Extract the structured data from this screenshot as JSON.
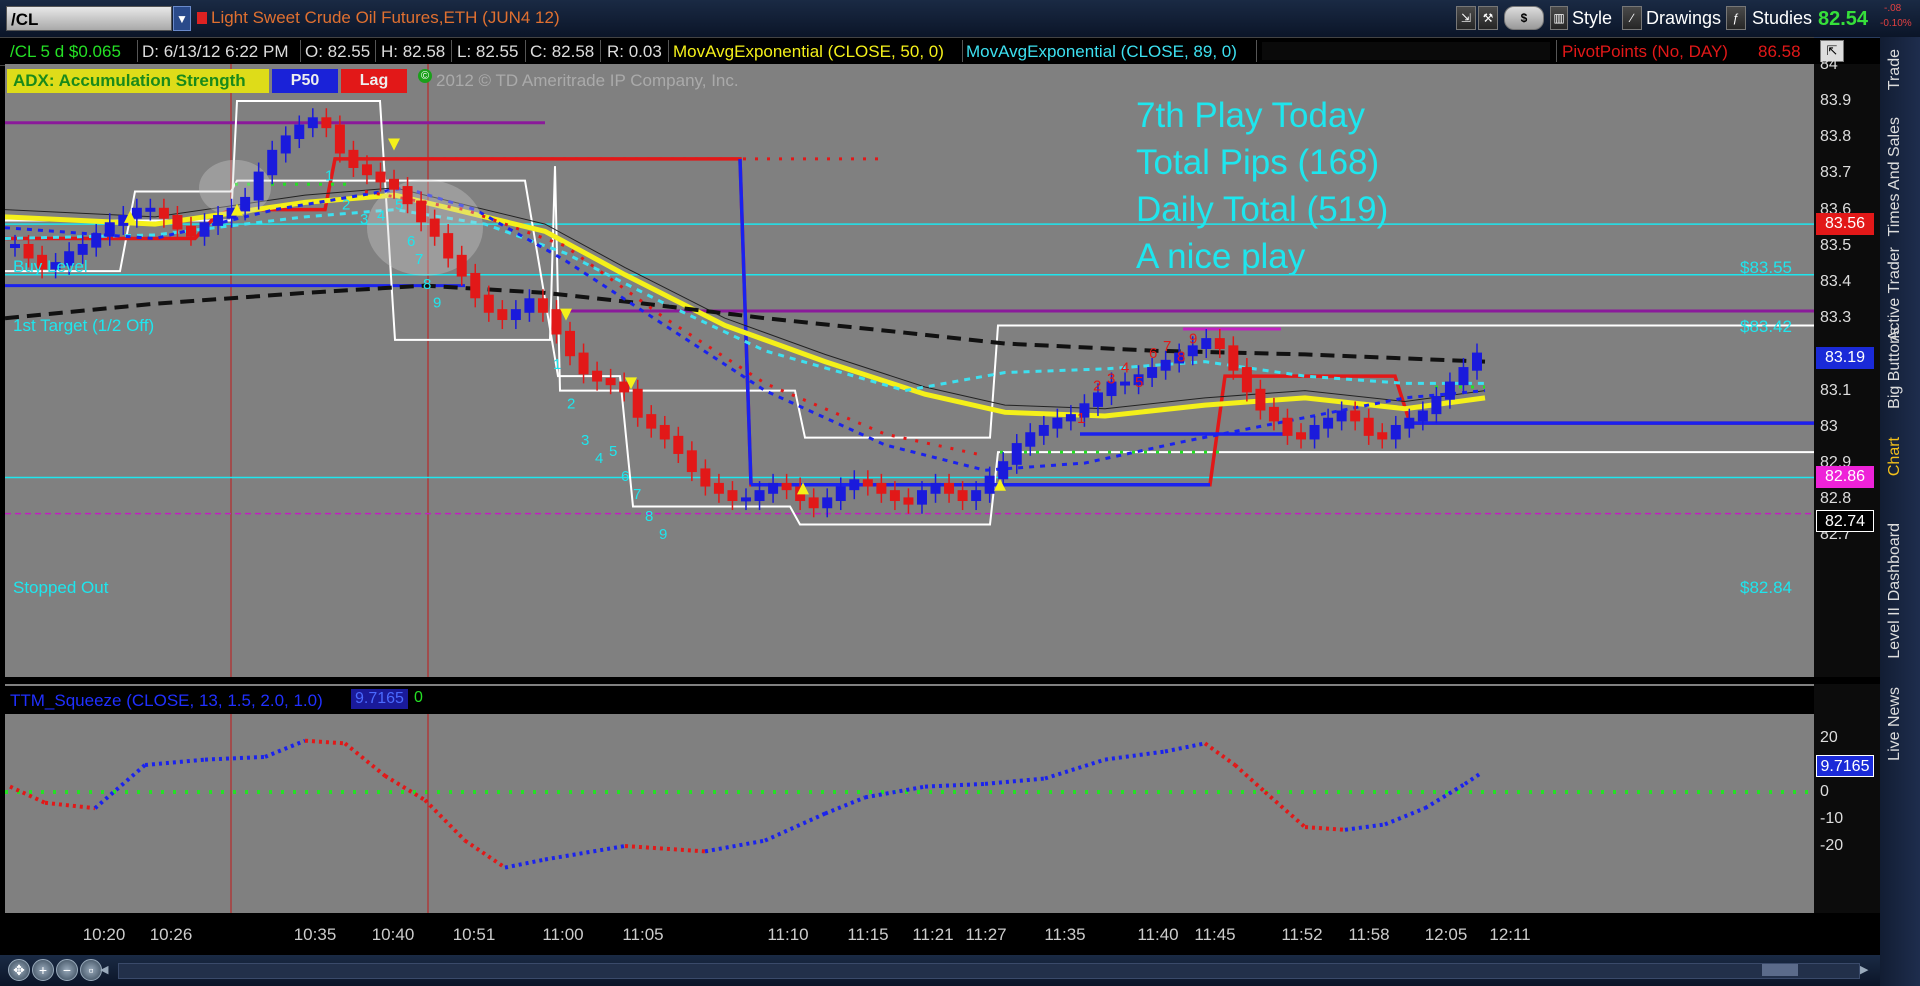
{
  "window": {
    "symbol": "/CL",
    "description": "Light Sweet Crude Oil Futures,ETH (JUN4 12)",
    "last_price": "82.54",
    "change_abs": "-.08",
    "change_pct": "-0.10%",
    "menus": [
      "Style",
      "Drawings",
      "Studies"
    ],
    "dollar_icon": "$"
  },
  "infobar": {
    "period": "/CL 5 d $0.065",
    "date": "D: 6/13/12 6:22 PM",
    "open": "O: 82.55",
    "high": "H: 82.58",
    "low": "L: 82.55",
    "close": "C: 82.58",
    "range": "R: 0.03",
    "ema50": "MovAvgExponential (CLOSE, 50, 0)",
    "ema89": "MovAvgExponential (CLOSE, 89, 0)",
    "pivot": "PivotPoints (No, DAY)",
    "pivot_value": "86.58"
  },
  "overlay": {
    "adx": "ADX:  Accumulation Strength",
    "p50": "P50",
    "lag": "Lag",
    "copyright": "2012 © TD Ameritrade IP Company, Inc."
  },
  "notes": [
    "7th Play Today",
    "Total Pips (168)",
    "Daily Total (519)",
    "A nice play"
  ],
  "levels": {
    "buy": "Buy Level",
    "target": "1st Target (1/2 Off)",
    "stopped": "Stopped Out",
    "buy_price": "$83.55",
    "target_price": "$83.42",
    "stopped_price": "$82.84"
  },
  "price_axis": {
    "ticks": [
      "84",
      "83.9",
      "83.8",
      "83.7",
      "83.6",
      "83.5",
      "83.4",
      "83.3",
      "83.2",
      "83.1",
      "83",
      "82.9",
      "82.8",
      "82.7"
    ],
    "tags": [
      {
        "text": "83.56",
        "bg": "#e21818",
        "fg": "#ffffff",
        "price": 83.56
      },
      {
        "text": "83.19",
        "bg": "#1a2ad8",
        "fg": "#ffffff",
        "price": 83.19
      },
      {
        "text": "82.86",
        "bg": "#ee22d8",
        "fg": "#ffffff",
        "price": 82.86
      },
      {
        "text": "82.74",
        "bg": "#000000",
        "fg": "#ffffff",
        "price": 82.74
      }
    ]
  },
  "squeeze": {
    "label": "TTM_Squeeze (CLOSE, 13, 1.5, 2.0, 1.0)",
    "value": "9.7165",
    "zero": "0",
    "ticks": [
      "20",
      "0",
      "-10",
      "-20"
    ],
    "tag": "9.7165"
  },
  "time_axis": [
    "10:20",
    "10:26",
    "10:35",
    "10:40",
    "10:51",
    "11:00",
    "11:05",
    "11:10",
    "11:15",
    "11:21",
    "11:27",
    "11:35",
    "11:40",
    "11:45",
    "11:52",
    "11:58",
    "12:05",
    "12:11"
  ],
  "sidebar_tabs": [
    "Trade",
    "Times And Sales",
    "Active Trader",
    "Big Buttons",
    "Chart",
    "Dashboard",
    "Level II",
    "Live News"
  ],
  "counts": {
    "up1": [
      "1",
      "2",
      "3",
      "4",
      "5",
      "6",
      "7",
      "8",
      "9"
    ],
    "dn1": [
      "1",
      "2",
      "3",
      "4",
      "5",
      "6",
      "7",
      "8",
      "9"
    ],
    "dn2": [
      "1",
      "2",
      "3",
      "4",
      "5",
      "6",
      "7",
      "8",
      "9"
    ],
    "up2": [
      "1",
      "2",
      "3",
      "4",
      "5",
      "6",
      "7",
      "8",
      "9"
    ]
  },
  "colors": {
    "bull": "#1a1adc",
    "bear": "#e21818",
    "ema50": "#f4f01a",
    "ema89": "#3de0f0",
    "cyan": "#1ee6ee",
    "purple": "#8a1a9a"
  }
}
